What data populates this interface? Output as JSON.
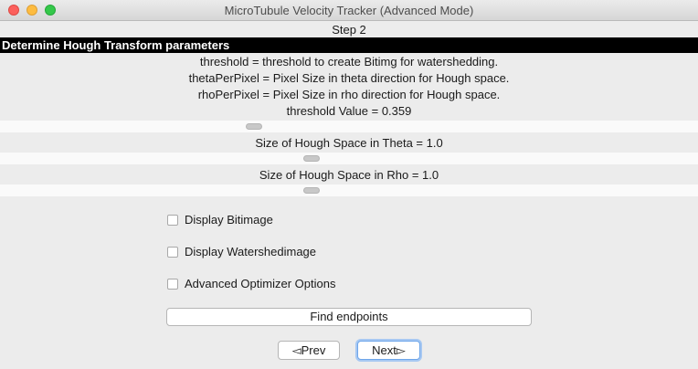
{
  "window": {
    "title": "MicroTubule Velocity Tracker (Advanced Mode)"
  },
  "step": "Step 2",
  "section": {
    "header": "Determine Hough Transform parameters",
    "descriptions": [
      "threshold = threshold to create Bitimg for watershedding.",
      "thetaPerPixel = Pixel Size in theta direction for Hough space.",
      "rhoPerPixel = Pixel Size in rho direction for Hough space."
    ]
  },
  "sliders": {
    "threshold": {
      "label": "threshold Value = 0.359",
      "value": 0.359
    },
    "theta": {
      "label": "Size of Hough Space in Theta = 1.0",
      "value": 1.0
    },
    "rho": {
      "label": "Size of Hough Space in Rho = 1.0",
      "value": 1.0
    }
  },
  "checkboxes": [
    {
      "label": "Display Bitimage",
      "checked": false
    },
    {
      "label": "Display Watershedimage",
      "checked": false
    },
    {
      "label": "Advanced Optimizer Options",
      "checked": false
    }
  ],
  "buttons": {
    "find_endpoints": "Find endpoints",
    "prev": "◅Prev",
    "next": "Next▻"
  }
}
